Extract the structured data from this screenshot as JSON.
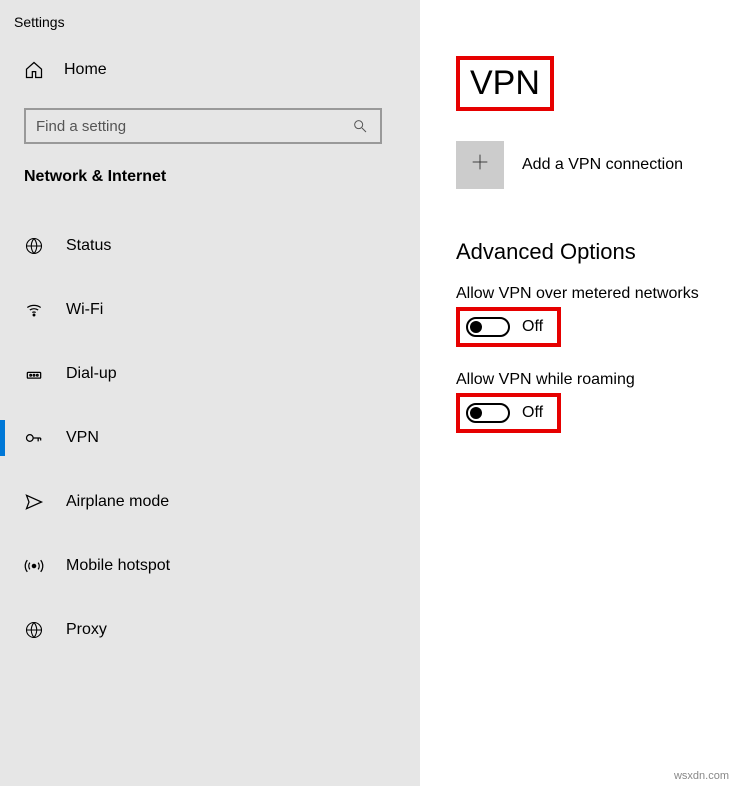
{
  "app": {
    "title": "Settings"
  },
  "sidebar": {
    "home_label": "Home",
    "search_placeholder": "Find a setting",
    "category": "Network & Internet",
    "items": [
      {
        "label": "Status"
      },
      {
        "label": "Wi-Fi"
      },
      {
        "label": "Dial-up"
      },
      {
        "label": "VPN"
      },
      {
        "label": "Airplane mode"
      },
      {
        "label": "Mobile hotspot"
      },
      {
        "label": "Proxy"
      }
    ]
  },
  "main": {
    "title": "VPN",
    "add_label": "Add a VPN connection",
    "advanced_title": "Advanced Options",
    "opts": [
      {
        "label": "Allow VPN over metered networks",
        "state": "Off"
      },
      {
        "label": "Allow VPN while roaming",
        "state": "Off"
      }
    ]
  },
  "watermark": "wsxdn.com"
}
